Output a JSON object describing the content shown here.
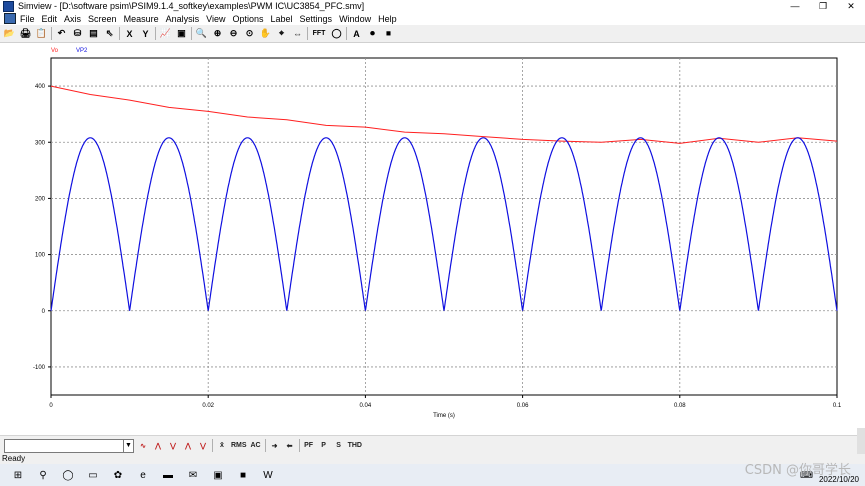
{
  "window": {
    "title": "Simview - [D:\\software psim\\PSIM9.1.4_softkey\\examples\\PWM IC\\UC3854_PFC.smv]",
    "controls": [
      "—",
      "❐",
      "✕"
    ]
  },
  "menu": [
    "File",
    "Edit",
    "Axis",
    "Screen",
    "Measure",
    "Analysis",
    "View",
    "Options",
    "Label",
    "Settings",
    "Window",
    "Help"
  ],
  "toolbar": {
    "buttons": [
      {
        "icon": "open-icon",
        "text": "📂"
      },
      {
        "icon": "print-icon",
        "text": "🖨"
      },
      {
        "icon": "copy-icon",
        "text": "📋"
      },
      {
        "icon": "undo-icon",
        "text": "↶"
      },
      {
        "icon": "data-icon",
        "text": "⛁"
      },
      {
        "icon": "tile-icon",
        "text": "▤"
      },
      {
        "icon": "select-icon",
        "text": "⇖"
      },
      {
        "icon": "x-axis-icon",
        "text": "X"
      },
      {
        "icon": "y-axis-icon",
        "text": "Y"
      },
      {
        "icon": "plot-icon",
        "text": "📈"
      },
      {
        "icon": "screen-icon",
        "text": "▣"
      },
      {
        "icon": "zoom-icon",
        "text": "🔍"
      },
      {
        "icon": "zoom-in-icon",
        "text": "⊕"
      },
      {
        "icon": "zoom-out-icon",
        "text": "⊖"
      },
      {
        "icon": "zoom-fit-icon",
        "text": "⊙"
      },
      {
        "icon": "hand-icon",
        "text": "✋"
      },
      {
        "icon": "measure-icon",
        "text": "⌖"
      },
      {
        "icon": "cursor-icon",
        "text": "⇔"
      },
      {
        "icon": "fft-icon",
        "text": "FFT"
      },
      {
        "icon": "circle-icon",
        "text": "◯"
      },
      {
        "icon": "label-icon",
        "text": "A"
      },
      {
        "icon": "record-icon",
        "text": "⏺"
      },
      {
        "icon": "stop-icon",
        "text": "⏹"
      }
    ]
  },
  "bottombar": {
    "combo_value": "",
    "buttons": [
      {
        "icon": "wave-icon",
        "text": "∿"
      },
      {
        "icon": "max-icon",
        "text": "⋀"
      },
      {
        "icon": "min-icon",
        "text": "⋁"
      },
      {
        "icon": "peak-icon",
        "text": "⋀"
      },
      {
        "icon": "valley-icon",
        "text": "⋁"
      },
      {
        "icon": "avg-icon",
        "text": "x̄"
      },
      {
        "icon": "rms-icon",
        "text": "RMS"
      },
      {
        "icon": "ac-icon",
        "text": "AC"
      },
      {
        "icon": "right-arrow-icon",
        "text": "➜"
      },
      {
        "icon": "left-arrow-icon",
        "text": "⬅"
      },
      {
        "icon": "pf-icon",
        "text": "PF"
      },
      {
        "icon": "p-icon",
        "text": "P"
      },
      {
        "icon": "s-icon",
        "text": "S"
      },
      {
        "icon": "thd-icon",
        "text": "THD"
      }
    ]
  },
  "status": "Ready",
  "taskbar": {
    "icons": [
      {
        "icon": "windows-start-icon",
        "text": "⊞"
      },
      {
        "icon": "search-icon",
        "text": "⚲"
      },
      {
        "icon": "cortana-icon",
        "text": "◯"
      },
      {
        "icon": "task-view-icon",
        "text": "▭"
      },
      {
        "icon": "app-icon",
        "text": "✿"
      },
      {
        "icon": "edge-icon",
        "text": "e"
      },
      {
        "icon": "folder-icon",
        "text": "▬"
      },
      {
        "icon": "wechat-icon",
        "text": "✉"
      },
      {
        "icon": "app2-icon",
        "text": "▣"
      },
      {
        "icon": "simview-icon",
        "text": "■"
      },
      {
        "icon": "word-icon",
        "text": "W"
      }
    ],
    "date": "2022/10/20",
    "watermark": "CSDN @你哥学长"
  },
  "chart_data": {
    "type": "line",
    "xlabel": "Time (s)",
    "ylabel": "",
    "xlim": [
      0,
      0.1
    ],
    "ylim": [
      -150,
      450
    ],
    "xticks": [
      "0",
      "0.02",
      "0.04",
      "0.06",
      "0.08",
      "0.1"
    ],
    "xtick_values": [
      0,
      0.02,
      0.04,
      0.06,
      0.08,
      0.1
    ],
    "yticks": [
      "400",
      "300",
      "200",
      "100",
      "0",
      "-100"
    ],
    "ytick_values": [
      400,
      300,
      200,
      100,
      0,
      -100
    ],
    "grid": true,
    "legend": "top-left",
    "series": [
      {
        "name": "Vo",
        "color": "#ff2020",
        "x": [
          0,
          0.005,
          0.01,
          0.015,
          0.02,
          0.025,
          0.03,
          0.035,
          0.04,
          0.045,
          0.05,
          0.055,
          0.06,
          0.065,
          0.07,
          0.075,
          0.08,
          0.085,
          0.09,
          0.095,
          0.1
        ],
        "y": [
          400,
          385,
          375,
          362,
          355,
          345,
          340,
          330,
          327,
          318,
          315,
          310,
          305,
          302,
          300,
          305,
          298,
          307,
          300,
          308,
          302
        ]
      },
      {
        "name": "VP2",
        "color": "#1010e0",
        "amplitude": 308,
        "frequency_hz": 50,
        "waveform": "rectified-sine",
        "x_start": 0,
        "x_end": 0.1
      }
    ]
  }
}
